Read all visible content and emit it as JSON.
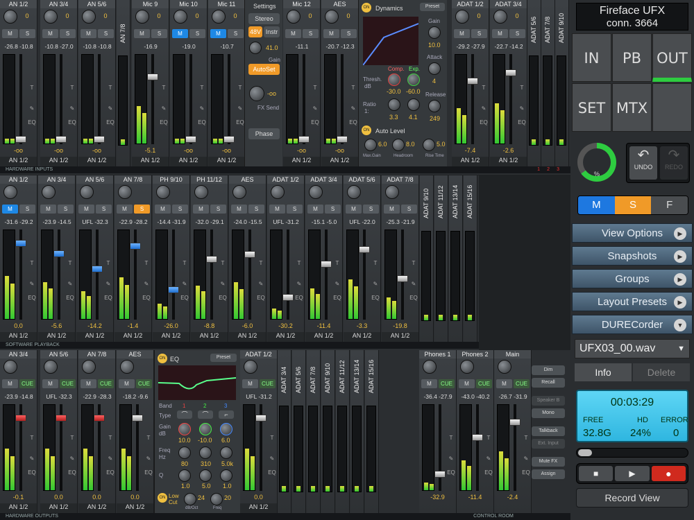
{
  "hw_inputs": {
    "label": "HARDWARE INPUTS",
    "strips": [
      {
        "name": "AN 1/2",
        "gain": "0",
        "peaks": "-26.8  -10.8",
        "level": "-oo",
        "out": "AN 1/2"
      },
      {
        "name": "AN 3/4",
        "gain": "0",
        "peaks": "-10.8  -27.0",
        "level": "-oo",
        "out": "AN 1/2"
      },
      {
        "name": "AN 5/6",
        "gain": "0",
        "peaks": "-10.8  -10.8",
        "level": "-oo",
        "out": "AN 1/2"
      },
      {
        "name": "Mic 9",
        "gain": "0",
        "peaks": "-16.9",
        "level": "-5.1",
        "out": "AN 1/2"
      },
      {
        "name": "Mic 10",
        "gain": "0",
        "peaks": "-19.0",
        "level": "-oo",
        "out": "AN 1/2"
      },
      {
        "name": "Mic 11",
        "gain": "0",
        "peaks": "-10.7",
        "level": "-oo",
        "out": "AN 1/2"
      },
      {
        "name": "Mic 12",
        "gain": "0",
        "peaks": "-11.1",
        "level": "-oo",
        "out": "AN 1/2"
      },
      {
        "name": "AES",
        "gain": "0",
        "peaks": "-20.7  -12.3",
        "level": "-oo",
        "out": "AN 1/2"
      },
      {
        "name": "ADAT 1/2",
        "gain": "0",
        "peaks": "-29.2  -27.9",
        "level": "-7.4",
        "out": "AN 1/2"
      },
      {
        "name": "ADAT 3/4",
        "gain": "0",
        "peaks": "-22.7  -14.2",
        "level": "-2.6",
        "out": "AN 1/2"
      }
    ],
    "narrow": [
      "AN 7/8",
      "ADAT 5/6",
      "ADAT 7/8",
      "ADAT 9/10"
    ],
    "settings": {
      "title": "Settings",
      "stereo": "Stereo",
      "p48": "48V",
      "instr": "Instr",
      "gain_val": "41.0",
      "gain_lbl": "Gain",
      "autoset": "AutoSet",
      "fx_val": "-oo",
      "fx_lbl": "FX Send",
      "phase": "Phase"
    },
    "dynamics": {
      "on": "ON",
      "title": "Dynamics",
      "preset": "Preset",
      "gain_lbl": "Gain",
      "gain": "10.0",
      "attack_lbl": "Attack",
      "attack": "4",
      "release_lbl": "Release",
      "release": "249",
      "thresh_lbl": "Thresh.",
      "thresh_unit": "dB",
      "comp": "Comp.",
      "exp": "Exp.",
      "thresh_comp": "-30.0",
      "thresh_exp": "-60.0",
      "ratio_lbl": "Ratio",
      "ratio_unit": "1:",
      "ratio_comp": "3.3",
      "ratio_exp": "4.1"
    },
    "autolevel": {
      "on": "ON",
      "title": "Auto Level",
      "max_gain": "6.0",
      "max_gain_lbl": "Max.Gain",
      "headroom": "8.0",
      "headroom_lbl": "Headroom",
      "rise": "5.0",
      "rise_lbl": "Rise Time"
    },
    "pages": [
      "1",
      "2",
      "3"
    ]
  },
  "sw_playback": {
    "label": "SOFTWARE PLAYBACK",
    "strips": [
      {
        "name": "AN 1/2",
        "peaks": "-31.6  -29.2",
        "level": "0.0",
        "out": "AN 1/2"
      },
      {
        "name": "AN 3/4",
        "peaks": "-23.9  -14.5",
        "level": "-5.6",
        "out": "AN 1/2"
      },
      {
        "name": "AN 5/6",
        "peaks": "UFL  -32.3",
        "level": "-14.2",
        "out": "AN 1/2"
      },
      {
        "name": "AN 7/8",
        "peaks": "-22.9  -28.2",
        "level": "-1.4",
        "out": "AN 1/2"
      },
      {
        "name": "PH 9/10",
        "peaks": "-14.4  -31.9",
        "level": "-26.0",
        "out": "AN 1/2"
      },
      {
        "name": "PH 11/12",
        "peaks": "-32.0  -29.1",
        "level": "-8.8",
        "out": "AN 1/2"
      },
      {
        "name": "AES",
        "peaks": "-24.0  -15.5",
        "level": "-6.0",
        "out": "AN 1/2"
      },
      {
        "name": "ADAT 1/2",
        "peaks": "UFL  -31.2",
        "level": "-30.2",
        "out": "AN 1/2"
      },
      {
        "name": "ADAT 3/4",
        "peaks": "-15.1  -5.0",
        "level": "-11.4",
        "out": "AN 1/2"
      },
      {
        "name": "ADAT 5/6",
        "peaks": "UFL  -22.0",
        "level": "-3.3",
        "out": "AN 1/2"
      },
      {
        "name": "ADAT 7/8",
        "peaks": "-25.3  -21.9",
        "level": "-19.8",
        "out": "AN 1/2"
      }
    ],
    "narrow": [
      "ADAT 9/10",
      "ADAT 11/12",
      "ADAT 13/14",
      "ADAT 15/16"
    ]
  },
  "hw_outputs": {
    "label": "HARDWARE OUTPUTS",
    "strips": [
      {
        "name": "AN 3/4",
        "peaks": "-23.9  -14.8",
        "level": "-0.1",
        "out": "AN 1/2"
      },
      {
        "name": "AN 5/6",
        "peaks": "UFL  -32.3",
        "level": "0.0",
        "out": "AN 1/2"
      },
      {
        "name": "AN 7/8",
        "peaks": "-22.9  -28.3",
        "level": "0.0",
        "out": "AN 1/2"
      },
      {
        "name": "AES",
        "peaks": "-18.2  -9.6",
        "level": "0.0",
        "out": "AN 1/2"
      },
      {
        "name": "ADAT 1/2",
        "peaks": "UFL  -31.2",
        "level": "0.0",
        "out": "AN 1/2"
      }
    ],
    "narrow": [
      "ADAT 3/4",
      "ADAT 5/6",
      "ADAT 7/8",
      "ADAT 9/10",
      "ADAT 11/12",
      "ADAT 13/14",
      "ADAT 15/16"
    ],
    "eq": {
      "on": "ON",
      "title": "EQ",
      "preset": "Preset",
      "band": "Band",
      "b1": "1",
      "b2": "2",
      "b3": "3",
      "type": "Type",
      "gain": "Gain",
      "gain_unit": "dB",
      "g1": "10.0",
      "g2": "-10.0",
      "g3": "6.0",
      "freq": "Freq",
      "freq_unit": "Hz",
      "f1": "80",
      "f2": "310",
      "f3": "5.0k",
      "q": "Q",
      "q1": "1.0",
      "q2": "5.0",
      "q3": "1.0",
      "lowcut_on": "ON",
      "lowcut": "Low Cut",
      "lc_db": "24",
      "lc_db_lbl": "dB/Oct",
      "lc_freq": "20",
      "lc_freq_lbl": "Freq"
    }
  },
  "control_room": {
    "label": "CONTROL ROOM",
    "strips": [
      {
        "name": "Phones 1",
        "peaks": "-36.4  -27.9",
        "level": "-32.9"
      },
      {
        "name": "Phones 2",
        "peaks": "-43.0  -40.2",
        "level": "-11.4"
      },
      {
        "name": "Main",
        "peaks": "-26.7  -31.9",
        "level": "-2.4"
      }
    ],
    "buttons": [
      "Dim",
      "Recall",
      "Speaker B",
      "Mono",
      "Talkback",
      "Ext. Input",
      "Mute FX",
      "Assign"
    ]
  },
  "right": {
    "device": "Fireface  UFX",
    "conn": "conn. 3664",
    "matrix": [
      "IN",
      "PB",
      "OUT",
      "SET",
      "MTX",
      ""
    ],
    "percent": "%",
    "undo": "UNDO",
    "redo": "REDO",
    "m": "M",
    "s": "S",
    "f": "F",
    "menus": [
      "View Options",
      "Snapshots",
      "Groups",
      "Layout Presets",
      "DURECorder"
    ],
    "file": "UFX03_00.wav",
    "info": "Info",
    "delete": "Delete",
    "time": "00:03:29",
    "free_lbl": "FREE",
    "free": "32.8G",
    "hd_lbl": "HD",
    "hd": "24%",
    "err_lbl": "ERROR",
    "err": "0",
    "record_view": "Record View"
  }
}
